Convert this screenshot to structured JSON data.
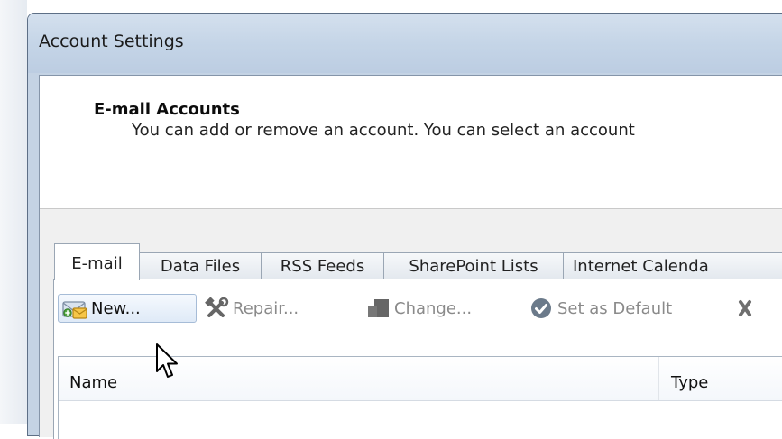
{
  "window": {
    "title": "Account Settings"
  },
  "header": {
    "title": "E-mail Accounts",
    "description": "You can add or remove an account. You can select an account"
  },
  "tabs": [
    {
      "label": "E-mail",
      "active": true
    },
    {
      "label": "Data Files",
      "active": false
    },
    {
      "label": "RSS Feeds",
      "active": false
    },
    {
      "label": "SharePoint Lists",
      "active": false
    },
    {
      "label": "Internet Calenda",
      "active": false
    }
  ],
  "toolbar": {
    "new_label": "New...",
    "repair_label": "Repair...",
    "change_label": "Change...",
    "set_default_label": "Set as Default"
  },
  "list": {
    "columns": [
      "Name",
      "Type"
    ]
  },
  "icons": {
    "new": "mail-add-icon",
    "repair": "tools-icon",
    "change": "card-change-icon",
    "set_default": "checkmark-circle-icon",
    "remove": "remove-x-icon"
  },
  "colors": {
    "title_bar": "#c5d5e7",
    "button_border": "#a6bcd7",
    "disabled_text": "#8a8a8a",
    "check_circle": "#6b7a8a"
  }
}
